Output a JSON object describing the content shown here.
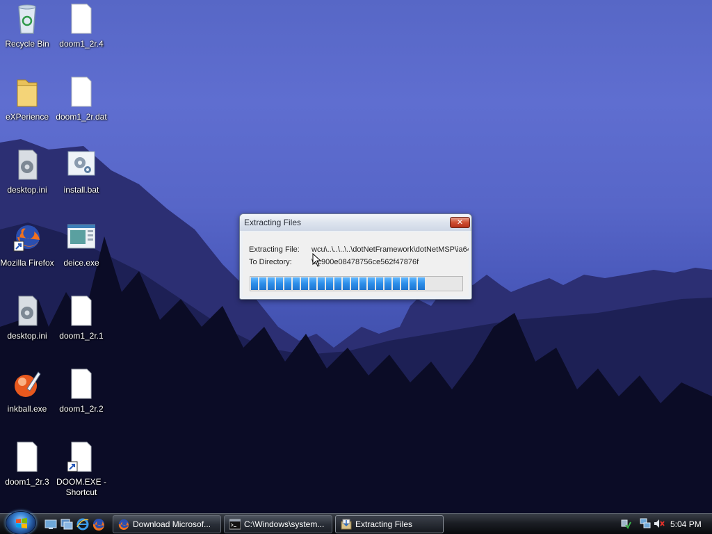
{
  "desktop": {
    "icons": [
      {
        "label": "Recycle Bin"
      },
      {
        "label": "doom1_2r.4"
      },
      {
        "label": "eXPerience"
      },
      {
        "label": "doom1_2r.dat"
      },
      {
        "label": "desktop.ini"
      },
      {
        "label": "install.bat"
      },
      {
        "label": "Mozilla Firefox"
      },
      {
        "label": "deice.exe"
      },
      {
        "label": "desktop.ini"
      },
      {
        "label": "doom1_2r.1"
      },
      {
        "label": "inkball.exe"
      },
      {
        "label": "doom1_2r.2"
      },
      {
        "label": "doom1_2r.3"
      },
      {
        "label": "DOOM.EXE - Shortcut"
      }
    ]
  },
  "dialog": {
    "title": "Extracting Files",
    "close_label": "✕",
    "extracting_label": "Extracting File:",
    "extracting_value": "wcu\\..\\..\\..\\..\\dotNetFramework\\dotNetMSP\\ia64",
    "directory_label": "To Directory:",
    "directory_value": "\\cc900e08478756ce562f47876f",
    "progress_fraction": 0.82
  },
  "taskbar": {
    "quick_launch": [
      "show-desktop-icon",
      "switch-windows-icon",
      "internet-explorer-icon",
      "firefox-icon"
    ],
    "buttons": [
      {
        "label": "Download Microsof...",
        "icon": "firefox-icon"
      },
      {
        "label": "C:\\Windows\\system...",
        "icon": "console-icon"
      },
      {
        "label": "Extracting Files",
        "icon": "installer-icon"
      }
    ],
    "clock": "5:04 PM"
  },
  "colors": {
    "sky": "#5a69cb",
    "progress_fill": "#2c8de8",
    "close_button": "#cf4f32"
  }
}
